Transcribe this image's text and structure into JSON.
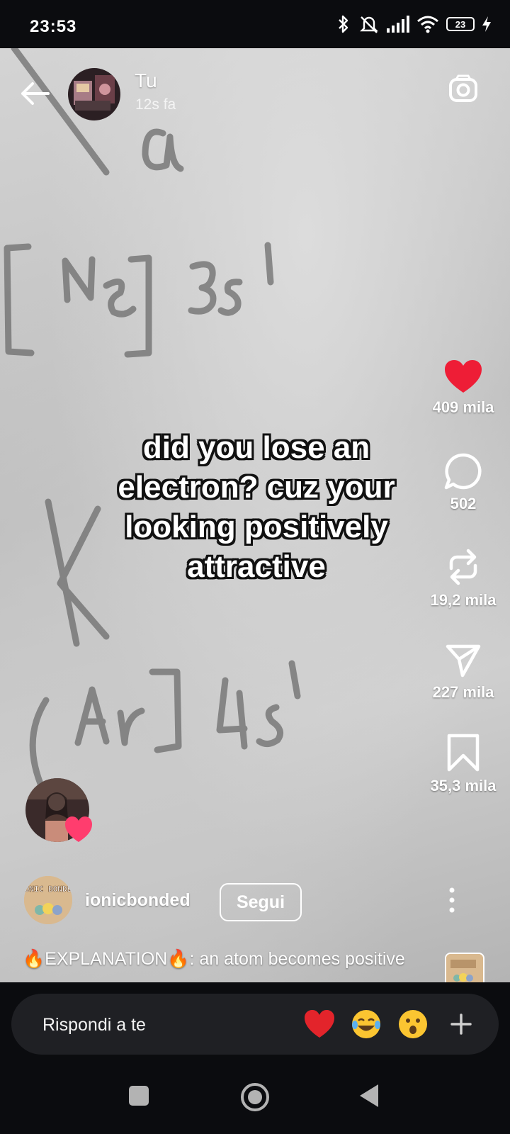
{
  "status_bar": {
    "time": "23:53",
    "battery": "23",
    "icons": [
      "bluetooth-icon",
      "mute-icon",
      "signal-icon",
      "wifi-icon",
      "battery-icon",
      "charging-icon"
    ]
  },
  "story": {
    "username": "Tu",
    "time_ago": "12s fa",
    "caption_overlay": "did you lose an electron? cuz your looking positively attractive",
    "actions": {
      "likes": "409 mila",
      "comments": "502",
      "reposts": "19,2 mila",
      "shares": "227 mila",
      "saves": "35,3 mila"
    },
    "account": {
      "name": "ionicbonded",
      "follow_label": "Segui",
      "avatar_text": "IONIC BONDED"
    },
    "description": {
      "prefix": "EXPLANATION",
      "text": ": an atom becomes positive ..."
    }
  },
  "reply": {
    "placeholder": "Rispondi a te",
    "emojis": [
      "red-heart",
      "tears-of-joy",
      "surprised-face"
    ]
  },
  "colors": {
    "like_red": "#ee1d36",
    "background": "#0b0c0f",
    "reply_bar": "#1f2024"
  }
}
